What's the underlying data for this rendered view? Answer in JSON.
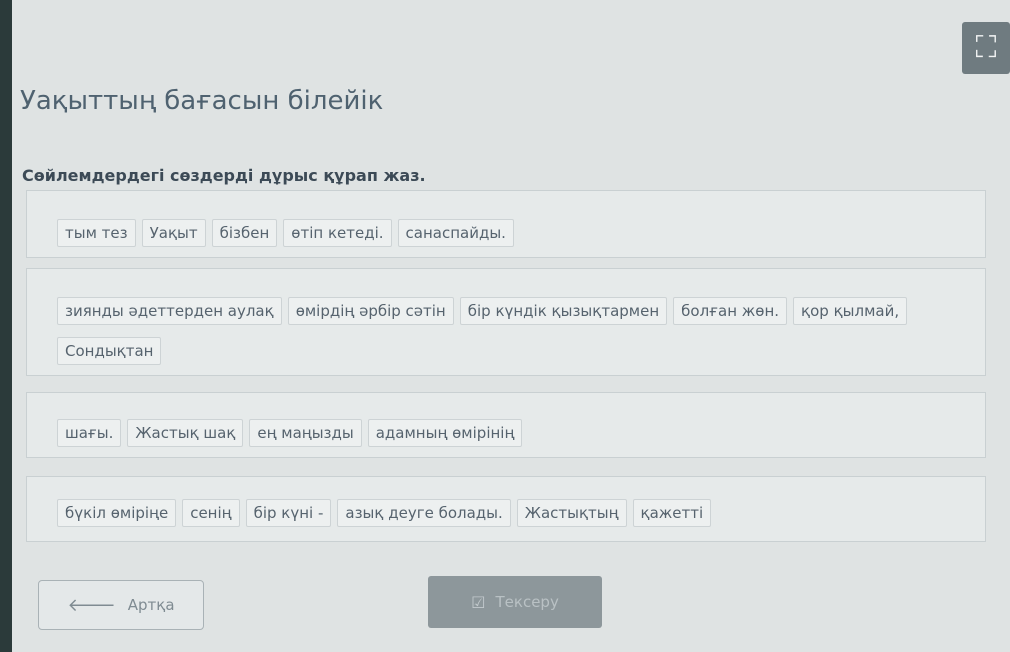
{
  "header": {
    "title": "Уақыттың бағасын білейік",
    "instruction": "Сөйлемдердегі сөздерді дұрыс құрап жаз."
  },
  "rows": [
    [
      "тым тез",
      "Уақыт",
      "бізбен",
      "өтіп кетеді.",
      "санаспайды."
    ],
    [
      "зиянды әдеттерден аулақ",
      "өмірдің әрбір сәтін",
      "бір күндік қызықтармен",
      "болған жөн.",
      "қор қылмай,",
      "Сондықтан"
    ],
    [
      "шағы.",
      "Жастық шақ",
      "ең маңызды",
      "адамның өмірінің"
    ],
    [
      "бүкіл өміріңе",
      "сенің",
      "бір күні -",
      "азық деуге болады.",
      "Жастықтың",
      "қажетті"
    ]
  ],
  "footer": {
    "back_label": "Артқа",
    "check_label": "Тексеру"
  },
  "icons": {
    "expand": "expand-icon",
    "back": "arrow-left-icon",
    "check": "checkbox-icon"
  }
}
